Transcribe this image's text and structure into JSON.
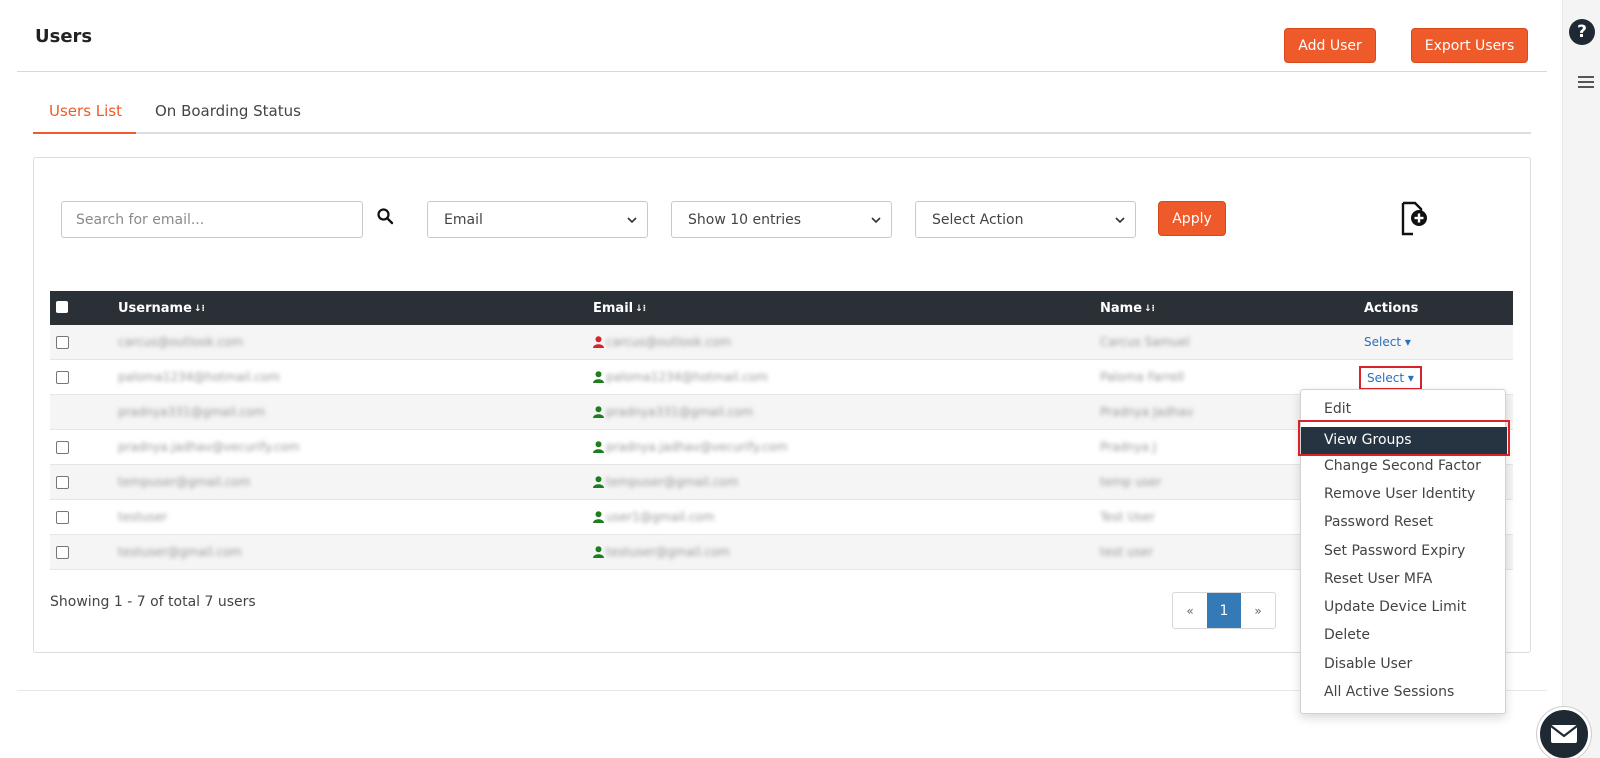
{
  "header": {
    "title": "Users",
    "add_user_label": "Add User",
    "export_users_label": "Export Users"
  },
  "rail": {
    "help_icon": "?"
  },
  "tabs": [
    {
      "label": "Users List",
      "active": true
    },
    {
      "label": "On Boarding Status",
      "active": false
    }
  ],
  "toolbar": {
    "search_placeholder": "Search for email...",
    "filter_select": "Email",
    "entries_select": "Show 10 entries",
    "action_select": "Select Action",
    "apply_label": "Apply"
  },
  "table": {
    "columns": [
      "Username",
      "Email",
      "Name",
      "Actions"
    ],
    "rows": [
      {
        "username": "carcus@outlook.com",
        "email": "carcus@outlook.com",
        "name": "Carcus Samuel",
        "status_color": "#d8232a",
        "checkbox": true,
        "action": "Select"
      },
      {
        "username": "paloma1234@hotmail.com",
        "email": "paloma1234@hotmail.com",
        "name": "Paloma Farrell",
        "status_color": "#1e7d1e",
        "checkbox": true,
        "action": "Select"
      },
      {
        "username": "pradnya331@gmail.com",
        "email": "pradnya331@gmail.com",
        "name": "Pradnya Jadhav",
        "status_color": "#1e7d1e",
        "checkbox": false,
        "action": ""
      },
      {
        "username": "pradnya.jadhav@vecurify.com",
        "email": "pradnya.jadhav@vecurify.com",
        "name": "Pradnya J",
        "status_color": "#1e7d1e",
        "checkbox": true,
        "action": ""
      },
      {
        "username": "tempuser@gmail.com",
        "email": "tempuser@gmail.com",
        "name": "temp user",
        "status_color": "#1e7d1e",
        "checkbox": true,
        "action": ""
      },
      {
        "username": "testuser",
        "email": "user1@gmail.com",
        "name": "Test User",
        "status_color": "#1e7d1e",
        "checkbox": true,
        "action": ""
      },
      {
        "username": "testuser@gmail.com",
        "email": "testuser@gmail.com",
        "name": "test user",
        "status_color": "#1e7d1e",
        "checkbox": true,
        "action": ""
      }
    ]
  },
  "footer": {
    "showing_text": "Showing 1 - 7 of total 7 users",
    "pager_prev": "«",
    "pager_current": "1",
    "pager_next": "»"
  },
  "action_menu": {
    "items": [
      "Edit",
      "View Groups",
      "Change Second Factor",
      "Remove User Identity",
      "Password Reset",
      "Set Password Expiry",
      "Reset User MFA",
      "Update Device Limit",
      "Delete",
      "Disable User",
      "All Active Sessions"
    ],
    "highlighted_item": "View Groups"
  },
  "colors": {
    "accent": "#ee5a29",
    "table_header": "#2b3036",
    "link": "#2a6ebb",
    "highlight_border": "#d8232a"
  }
}
